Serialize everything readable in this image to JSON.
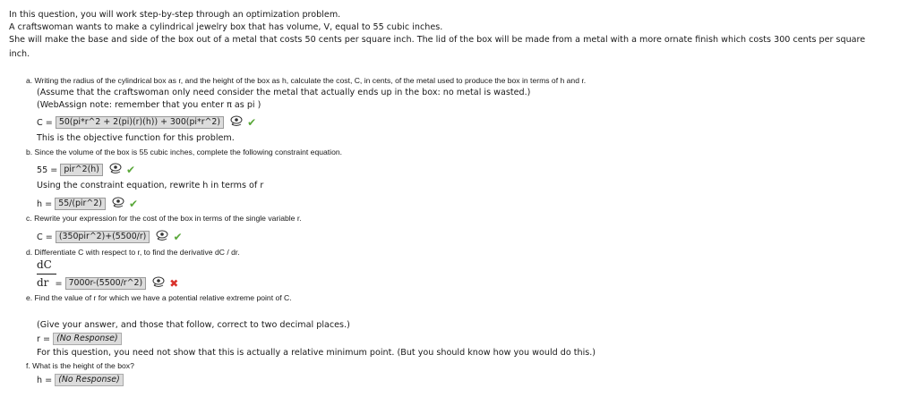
{
  "intro": [
    "In this question, you will work step-by-step through an optimization problem.",
    "A craftswoman wants to make a cylindrical jewelry box that has volume, V, equal to 55 cubic inches.",
    "She will make the base and side of the box out of a metal that costs 50 cents per square inch. The lid of the box will be made from a metal with a more ornate finish which costs 300 cents per square",
    "inch."
  ],
  "parts": {
    "a": {
      "prompt": "a. Writing the radius of the cylindrical box as r, and the height of the box as h, calculate the cost, C, in cents, of the metal used to produce the box in terms of h and r.",
      "note1": "(Assume that the craftswoman only need consider the metal that actually ends up in the box: no metal is wasted.)",
      "note2": "(WebAssign note: remember that you enter π as pi )",
      "lhs": "C =",
      "answer": "50(pi*r^2 + 2(pi)(r)(h)) + 300(pi*r^2)",
      "status": "correct",
      "after": "This is the objective function for this problem."
    },
    "b": {
      "prompt": "b. Since the volume of the box is 55 cubic inches, complete the following constraint equation.",
      "lhs": "55 =",
      "answer": "pir^2(h)",
      "status": "correct",
      "after": "Using the constraint equation, rewrite h in terms of r",
      "lhs2": "h =",
      "answer2": "55/(pir^2)",
      "status2": "correct"
    },
    "c": {
      "prompt": "c. Rewrite your expression for the cost of the box in terms of the single variable r.",
      "lhs": "C =",
      "answer": "(350pir^2)+(5500/r)",
      "status": "correct"
    },
    "d": {
      "prompt": "d. Differentiate C with respect to r, to find the derivative dC / dr.",
      "numerator": "dC",
      "denominator": "dr",
      "eq": "=",
      "answer": "7000r-(5500/r^2)",
      "status": "incorrect"
    },
    "e": {
      "prompt": "e. Find the value of r for which we have a potential relative extreme point of C.",
      "note": "(Give your answer, and those that follow, correct to two decimal places.)",
      "lhs": "r =",
      "answer": "(No Response)",
      "after": "For this question, you need not show that this is actually a relative minimum point. (But you should know how you would do this.)"
    },
    "f": {
      "prompt": "f. What is the height of the box?",
      "lhs": "h =",
      "answer": "(No Response)"
    }
  },
  "marks": {
    "correct": "✔",
    "incorrect": "✖"
  },
  "colors": {
    "correct": "#5aa83a",
    "incorrect": "#d9322c",
    "answer_bg": "#dcdcdc"
  }
}
